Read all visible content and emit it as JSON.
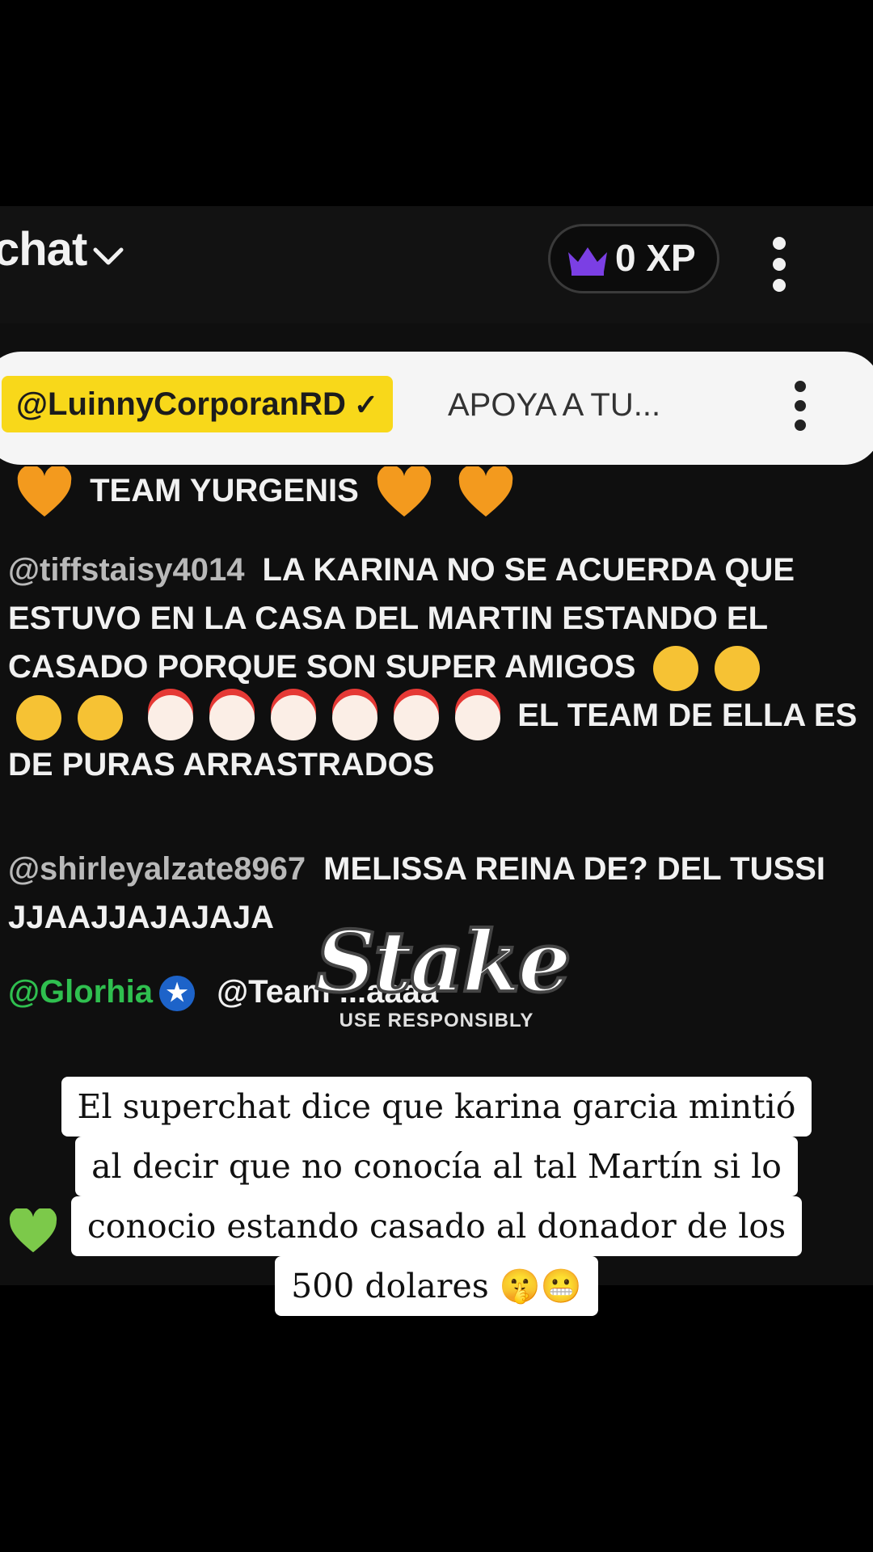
{
  "chat_header": {
    "title": "chat",
    "xp_label": "0 XP"
  },
  "pinned": {
    "username": "@LuinnyCorporanRD",
    "verified_mark": "✓",
    "message": "APOYA A TU..."
  },
  "messages": [
    {
      "author": "",
      "text": "TEAM YURGENIS"
    },
    {
      "author": "@tiffstaisy4014",
      "text": "LA KARINA NO SE ACUERDA QUE ESTUVO EN LA CASA DEL MARTIN ESTANDO EL CASADO PORQUE SON SUPER AMIGOS",
      "text2": "EL TEAM DE ELLA ES DE PURAS ARRASTRADOS"
    },
    {
      "author": "@shirleyalzate8967",
      "text": "MELISSA REINA DE? DEL TUSSI JJAAJJAJAJAJA"
    },
    {
      "author": "@Glorhia",
      "text": "@Team ...aaaa"
    }
  ],
  "watermark": {
    "brand": "Stake",
    "tagline": "USE RESPONSIBLY"
  },
  "caption": {
    "lines": [
      "El superchat dice que karina garcia mintió",
      "al decir que no conocía al tal Martín  si lo",
      "conocio estando casado al donador de los",
      "500 dolares 🤫😬"
    ]
  },
  "colors": {
    "pinned_user_bg": "#f8d81a",
    "crown": "#7b3fe4",
    "orange_heart": "#f39a1e",
    "green_heart": "#7cc94a",
    "glorhia_name": "#2fbf4f"
  }
}
